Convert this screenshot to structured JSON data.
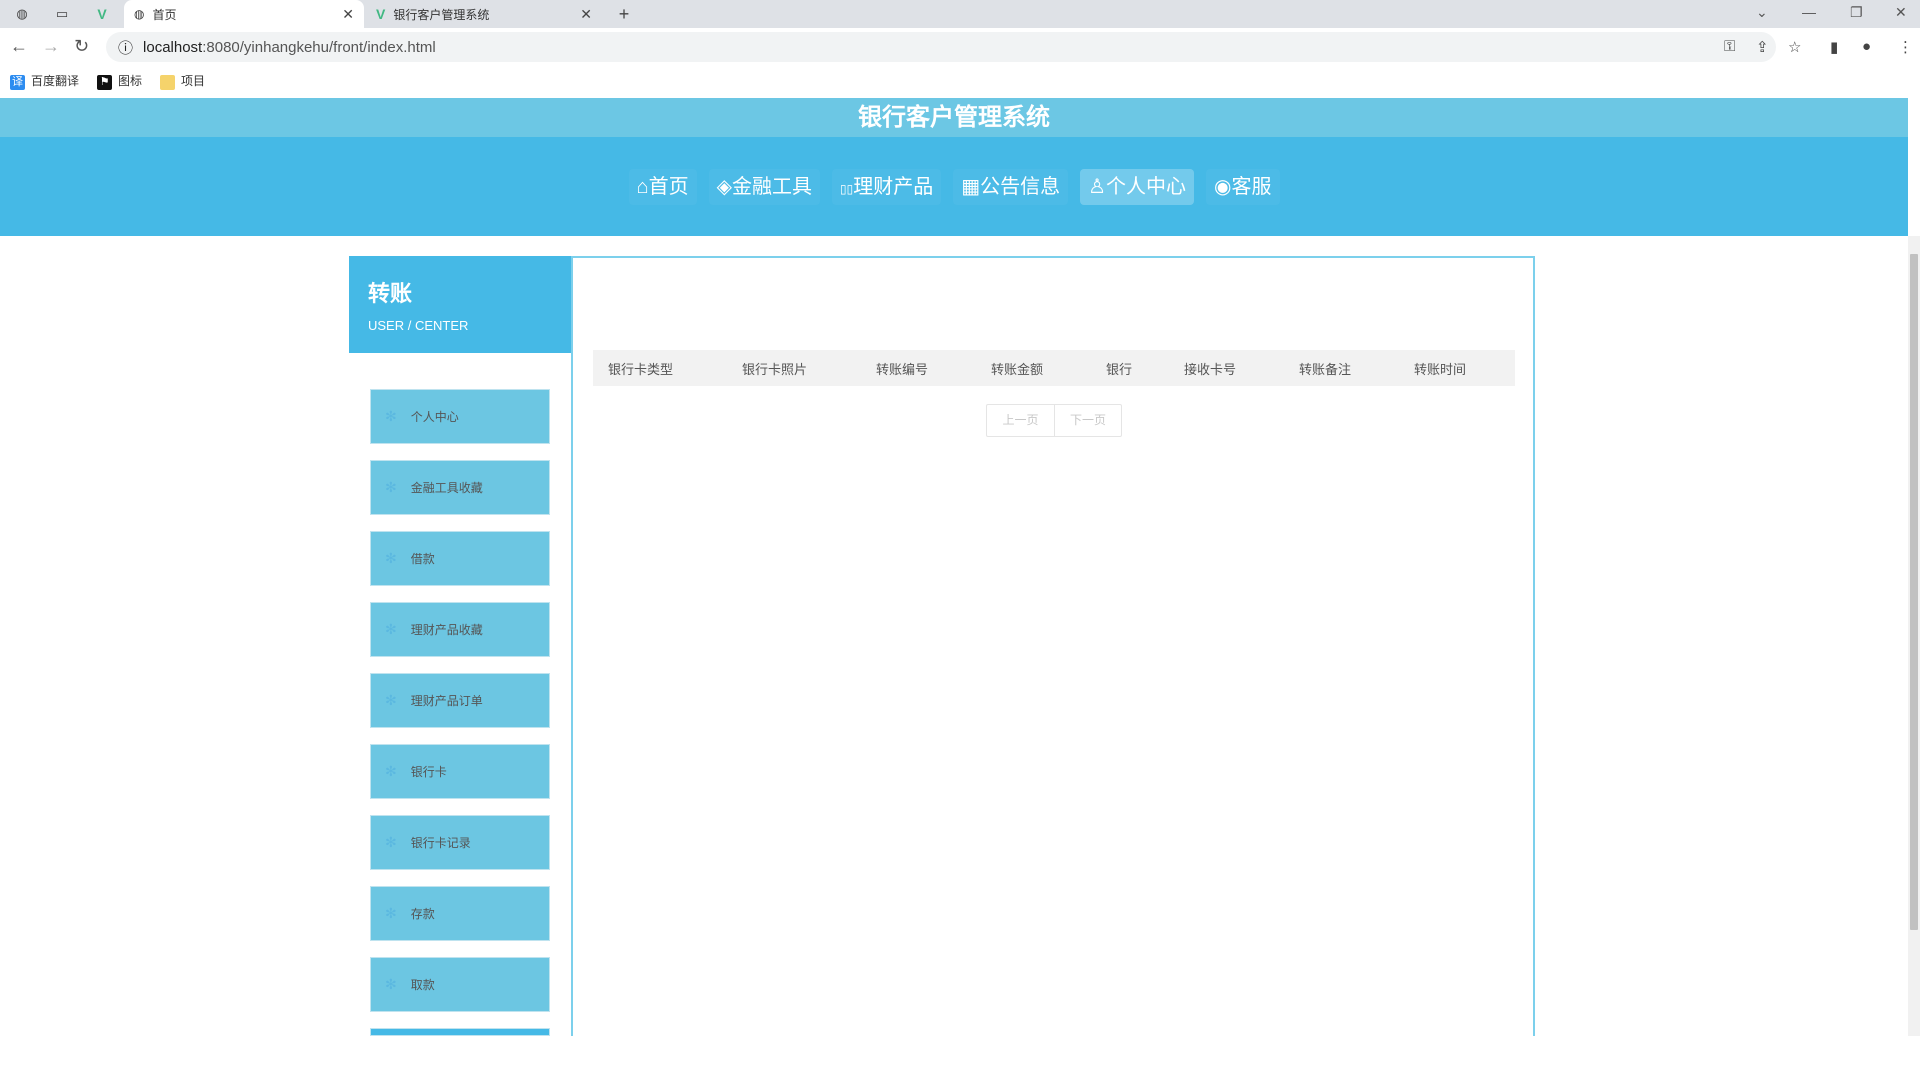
{
  "browser": {
    "tabs": [
      {
        "title": "首页",
        "active": true
      },
      {
        "title": "银行客户管理系统",
        "active": false
      }
    ],
    "url_host": "localhost",
    "url_rest": ":8080/yinhangkehu/front/index.html",
    "bookmarks": [
      {
        "label": "百度翻译",
        "icon": "translate-icon",
        "color": "#2d8cf0"
      },
      {
        "label": "图标",
        "icon": "flag-icon",
        "color": "#111111"
      },
      {
        "label": "项目",
        "icon": "folder-icon",
        "color": "#f5d36b"
      }
    ]
  },
  "site": {
    "title": "银行客户管理系统",
    "nav": [
      {
        "label": "首页",
        "icon": "⌂"
      },
      {
        "label": "金融工具",
        "icon": "◈"
      },
      {
        "label": "理财产品",
        "icon": "▯▯"
      },
      {
        "label": "公告信息",
        "icon": "▦"
      },
      {
        "label": "个人中心",
        "icon": "♙",
        "active": true
      },
      {
        "label": "客服",
        "icon": "◉"
      }
    ]
  },
  "sidebar": {
    "title": "转账",
    "subtitle": "USER / CENTER",
    "items": [
      "个人中心",
      "金融工具收藏",
      "借款",
      "理财产品收藏",
      "理财产品订单",
      "银行卡",
      "银行卡记录",
      "存款",
      "取款"
    ]
  },
  "table": {
    "columns": [
      "银行卡类型",
      "银行卡照片",
      "转账编号",
      "转账金额",
      "银行",
      "接收卡号",
      "转账备注",
      "转账时间"
    ]
  },
  "pager": {
    "prev": "上一页",
    "next": "下一页"
  },
  "colors": {
    "title_band": "#6cc7e4",
    "nav": "#45b9e6",
    "side_button": "#6cc6e2"
  }
}
